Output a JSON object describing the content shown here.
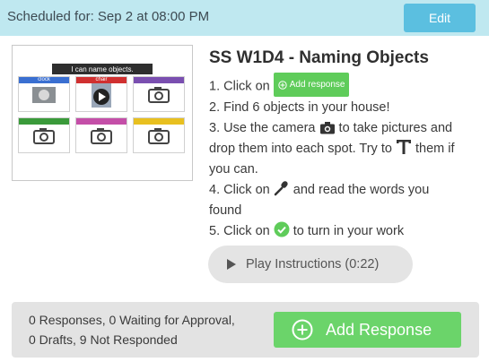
{
  "header": {
    "scheduled_text": "Scheduled for: Sep 2 at 08:00 PM",
    "edit_label": "Edit"
  },
  "thumbnail": {
    "banner_text": "I can name objects.",
    "cells": [
      {
        "label": "clock",
        "color": "#3a6fd1"
      },
      {
        "label": "chair",
        "color": "#d03030"
      },
      {
        "label": "",
        "color": "#7a4fb0"
      },
      {
        "label": "",
        "color": "#3a9a3a"
      },
      {
        "label": "",
        "color": "#c44fa8"
      },
      {
        "label": "",
        "color": "#e8c020"
      }
    ]
  },
  "activity": {
    "title": "SS W1D4 - Naming Objects",
    "step1_prefix": "1. Click on",
    "step1_chip": "Add response",
    "step2": "2. Find 6 objects in your house!",
    "step3_a": "3. Use the camera",
    "step3_b": "to take pictures and",
    "step3_c": "drop them into each spot. Try to",
    "step3_d": "them if",
    "step3_e": "you can.",
    "step4_a": "4. Click on",
    "step4_b": "and read the words you",
    "step4_c": "found",
    "step5_a": "5. Click on",
    "step5_b": "to turn in your work"
  },
  "play": {
    "label": "Play Instructions (0:22)"
  },
  "footer": {
    "counts_line1": "0 Responses, 0 Waiting for Approval,",
    "counts_line2": "0 Drafts, 9 Not Responded",
    "add_response_label": "Add Response"
  },
  "colors": {
    "topbar": "#bfe8f0",
    "edit": "#5bbfe0",
    "green": "#6bd46a"
  }
}
